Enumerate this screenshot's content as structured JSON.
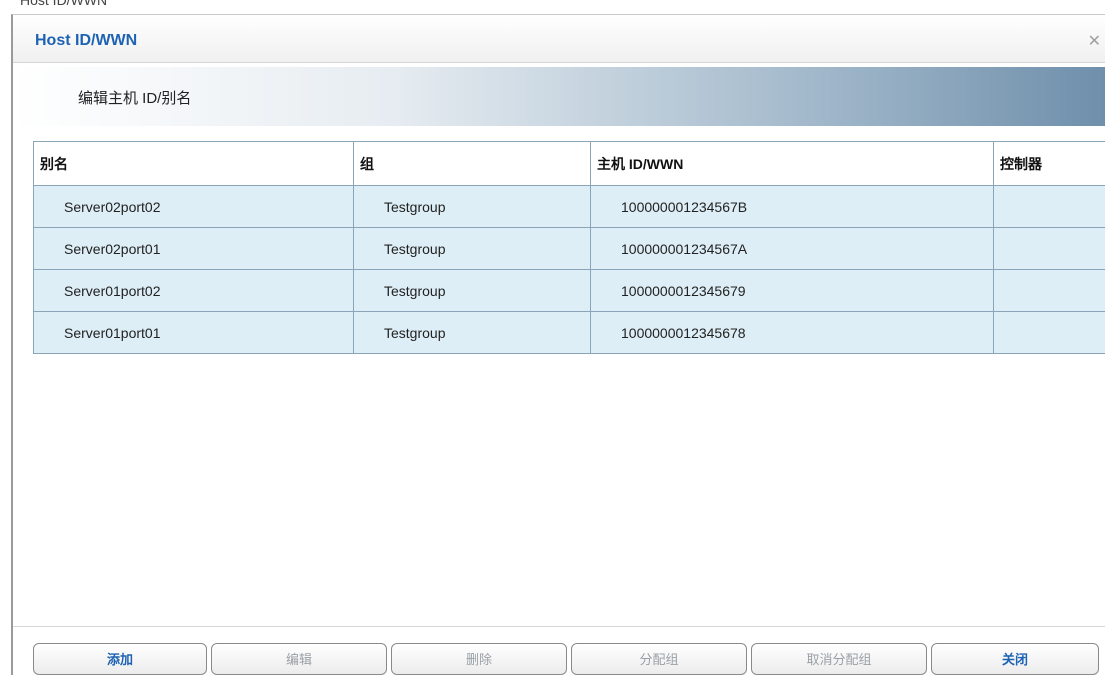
{
  "backdrop": {
    "partial_text": "Host  ID/WWN"
  },
  "dialog": {
    "title": "Host ID/WWN",
    "close_symbol": "✕",
    "subtitle": "编辑主机 ID/别名",
    "table": {
      "columns": [
        "别名",
        "组",
        "主机 ID/WWN",
        "控制器"
      ],
      "rows": [
        {
          "alias": "Server02port02",
          "group": "Testgroup",
          "hostid": "100000001234567B",
          "controller": ""
        },
        {
          "alias": "Server02port01",
          "group": "Testgroup",
          "hostid": "100000001234567A",
          "controller": ""
        },
        {
          "alias": "Server01port02",
          "group": "Testgroup",
          "hostid": "1000000012345679",
          "controller": ""
        },
        {
          "alias": "Server01port01",
          "group": "Testgroup",
          "hostid": "1000000012345678",
          "controller": ""
        }
      ]
    },
    "buttons": {
      "add": "添加",
      "edit": "编辑",
      "delete": "删除",
      "assign_group": "分配组",
      "unassign_group": "取消分配组",
      "close": "关闭"
    }
  },
  "colors": {
    "title": "#1e63b3",
    "row_background": "#ddeef6",
    "border": "#8aa4b8"
  }
}
